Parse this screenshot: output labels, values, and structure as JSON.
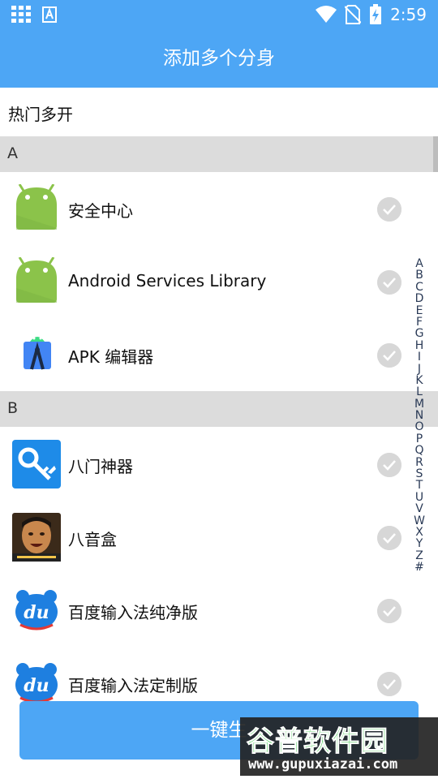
{
  "status_bar": {
    "time": "2:59"
  },
  "header": {
    "title": "添加多个分身"
  },
  "hot_label": "热门多开",
  "sections": [
    {
      "letter": "A",
      "apps": [
        {
          "name": "安全中心",
          "icon": "android-robot-icon"
        },
        {
          "name": "Android Services Library",
          "icon": "android-robot-icon"
        },
        {
          "name": "APK 编辑器",
          "icon": "android-studio-icon"
        }
      ]
    },
    {
      "letter": "B",
      "apps": [
        {
          "name": "八门神器",
          "icon": "key-wrench-icon"
        },
        {
          "name": "八音盒",
          "icon": "face-photo-icon"
        },
        {
          "name": "百度输入法纯净版",
          "icon": "baidu-du-icon"
        },
        {
          "name": "百度输入法定制版",
          "icon": "baidu-du-icon"
        }
      ]
    }
  ],
  "alphabet_index": [
    "A",
    "B",
    "C",
    "D",
    "E",
    "F",
    "G",
    "H",
    "I",
    "J",
    "K",
    "L",
    "M",
    "N",
    "O",
    "P",
    "Q",
    "R",
    "S",
    "T",
    "U",
    "V",
    "W",
    "X",
    "Y",
    "Z",
    "#"
  ],
  "bottom_button": {
    "label": "一键生"
  },
  "watermark": {
    "title": "谷普软件园",
    "url": "www.gupuxiazai.com"
  },
  "colors": {
    "primary": "#4da6f5",
    "section_bg": "#dcdcdc",
    "android_green": "#8bc34a",
    "check_gray": "#d7d7d7"
  }
}
